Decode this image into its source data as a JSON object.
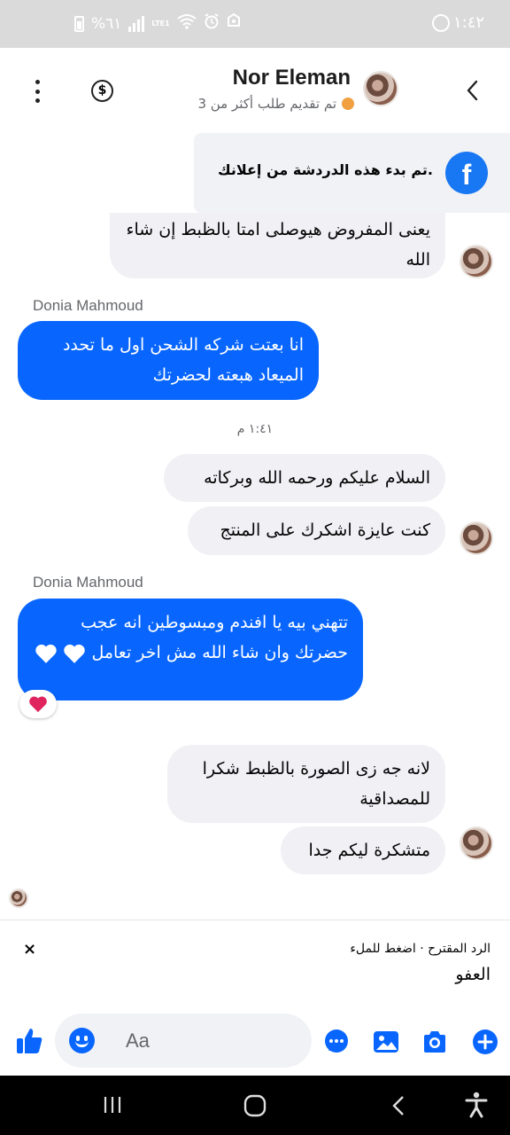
{
  "status_bar": {
    "time": "١:٤٢",
    "battery": "%٦١",
    "network": "LTE1"
  },
  "header": {
    "title": "Nor Eleman",
    "subtitle": "تم تقديم طلب   أكثر من 3",
    "status_color": "#f0a040"
  },
  "ad_banner": {
    "text": "تم بدء هذه الدردشة من إعلانك.",
    "logo_letter": "f"
  },
  "messages": [
    {
      "direction": "incoming",
      "text": "يعنى المفروض هيوصلى امتا بالظبط إن شاء الله"
    },
    {
      "sender": "Donia Mahmoud",
      "direction": "outgoing",
      "text": "انا بعتت شركه الشحن اول ما تحدد الميعاد هبعته لحضرتك"
    },
    {
      "time_separator": "١:٤١ م"
    },
    {
      "direction": "incoming",
      "text": "السلام عليكم ورحمه الله وبركاته"
    },
    {
      "direction": "incoming",
      "text": "كنت عايزة اشكرك على المنتج"
    },
    {
      "sender": "Donia Mahmoud",
      "direction": "outgoing",
      "text": "تتهني بيه يا افندم ومبسوطين انه عجب حضرتك وان شاء الله مش اخر تعامل",
      "reaction": "heart"
    },
    {
      "direction": "incoming",
      "text": "لانه جه زى الصورة بالظبط شكرا للمصداقية"
    },
    {
      "direction": "incoming",
      "text": "متشكرة ليكم جدا"
    }
  ],
  "suggested_reply": {
    "label": "الرد المقترح · اضغط للملء",
    "text": "العفو",
    "close": "×"
  },
  "composer": {
    "placeholder": "Aa"
  },
  "colors": {
    "brand_blue": "#0866ff",
    "incoming_bubble": "#f0f0f5",
    "reaction_heart": "#e0245e"
  }
}
